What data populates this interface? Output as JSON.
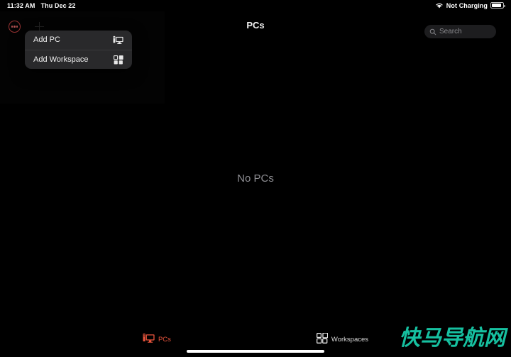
{
  "status_bar": {
    "time": "11:32 AM",
    "date": "Thu Dec 22",
    "wifi_icon": "wifi-icon",
    "battery_status": "Not Charging",
    "battery_icon": "battery-icon",
    "battery_level_percent": 82
  },
  "nav_bar": {
    "title": "PCs",
    "more_button_icon": "ellipsis-circle-icon",
    "add_button_icon": "plus-icon"
  },
  "search": {
    "value": "",
    "placeholder": "Search",
    "icon": "search-icon"
  },
  "popup_menu": {
    "items": [
      {
        "label": "Add PC",
        "icon": "desktop-computer-icon"
      },
      {
        "label": "Add Workspace",
        "icon": "grid-squares-icon"
      }
    ]
  },
  "main": {
    "empty_state_text": "No PCs"
  },
  "tab_bar": {
    "tabs": [
      {
        "label": "PCs",
        "icon": "desktop-computer-icon",
        "active": true
      },
      {
        "label": "Workspaces",
        "icon": "grid-squares-icon",
        "active": false
      }
    ]
  },
  "watermark": {
    "text": "快马导航网"
  },
  "colors": {
    "background": "#000000",
    "accent_red": "#e8543c",
    "popup_background": "#29292b",
    "search_background": "#1d1d1f",
    "secondary_text": "#8e8e93",
    "watermark_teal": "#16c0a0"
  }
}
